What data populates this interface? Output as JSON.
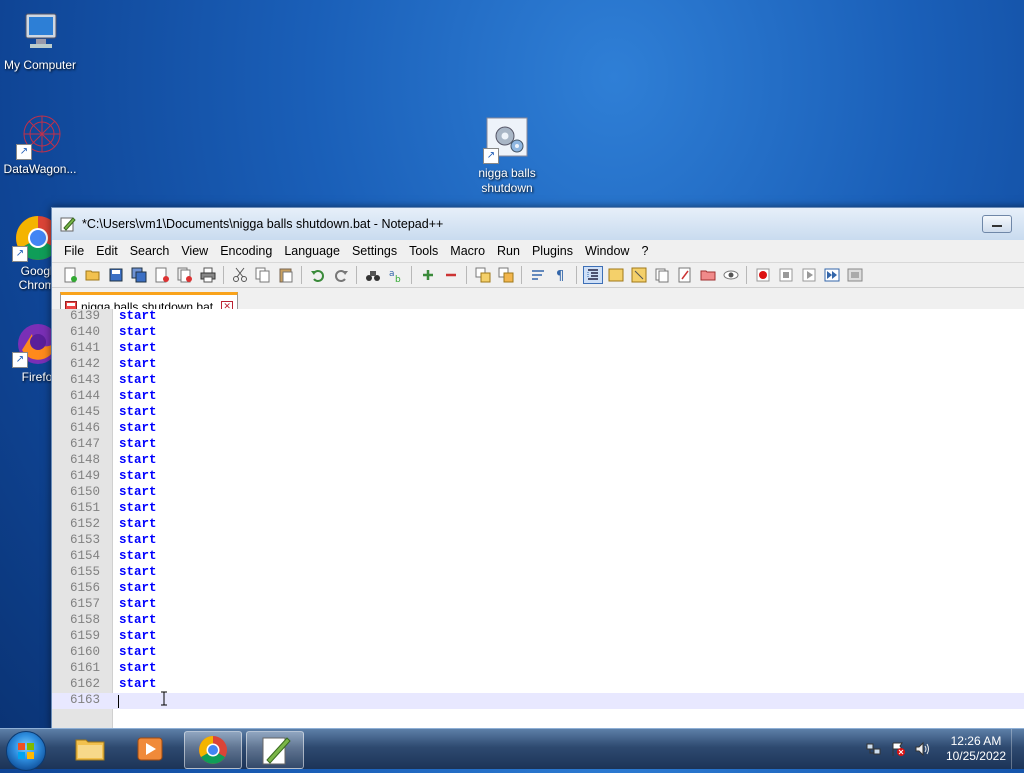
{
  "desktop": {
    "icons": [
      {
        "label": "My Computer"
      },
      {
        "label": "DataWagon..."
      },
      {
        "label": "Google Chrome"
      },
      {
        "label": "Firefox"
      },
      {
        "label": "nigga balls shutdown"
      }
    ]
  },
  "window": {
    "title": "*C:\\Users\\vm1\\Documents\\nigga balls shutdown.bat - Notepad++",
    "menu": [
      "File",
      "Edit",
      "Search",
      "View",
      "Encoding",
      "Language",
      "Settings",
      "Tools",
      "Macro",
      "Run",
      "Plugins",
      "Window",
      "?"
    ],
    "tab_label": "nigga balls shutdown.bat",
    "lines": [
      {
        "num": "6139",
        "text": "start"
      },
      {
        "num": "6140",
        "text": "start"
      },
      {
        "num": "6141",
        "text": "start"
      },
      {
        "num": "6142",
        "text": "start"
      },
      {
        "num": "6143",
        "text": "start"
      },
      {
        "num": "6144",
        "text": "start"
      },
      {
        "num": "6145",
        "text": "start"
      },
      {
        "num": "6146",
        "text": "start"
      },
      {
        "num": "6147",
        "text": "start"
      },
      {
        "num": "6148",
        "text": "start"
      },
      {
        "num": "6149",
        "text": "start"
      },
      {
        "num": "6150",
        "text": "start"
      },
      {
        "num": "6151",
        "text": "start"
      },
      {
        "num": "6152",
        "text": "start"
      },
      {
        "num": "6153",
        "text": "start"
      },
      {
        "num": "6154",
        "text": "start"
      },
      {
        "num": "6155",
        "text": "start"
      },
      {
        "num": "6156",
        "text": "start"
      },
      {
        "num": "6157",
        "text": "start"
      },
      {
        "num": "6158",
        "text": "start"
      },
      {
        "num": "6159",
        "text": "start"
      },
      {
        "num": "6160",
        "text": "start"
      },
      {
        "num": "6161",
        "text": "start"
      },
      {
        "num": "6162",
        "text": "start"
      },
      {
        "num": "6163",
        "text": ""
      }
    ]
  },
  "taskbar": {
    "time": "12:26 AM",
    "date": "10/25/2022"
  },
  "colors": {
    "keyword": "#0000ff",
    "tab_accent": "#f9a31b",
    "current_line": "#e8e8ff"
  }
}
